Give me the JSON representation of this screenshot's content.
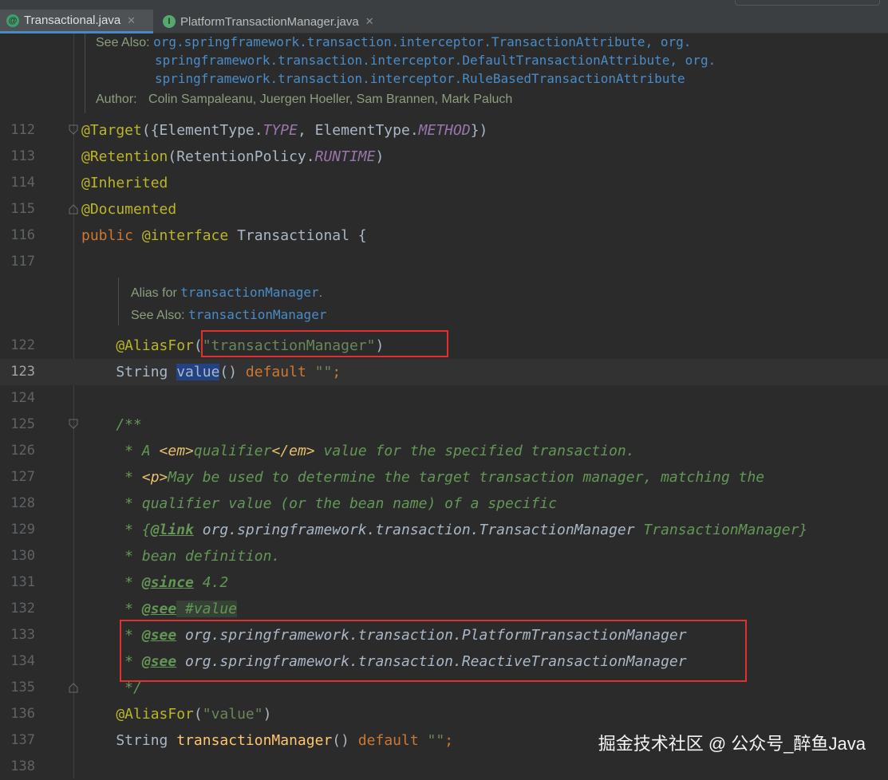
{
  "tabs": [
    {
      "label": "Transactional.java",
      "icon": "annotation-file-icon",
      "active": true
    },
    {
      "label": "PlatformTransactionManager.java",
      "icon": "interface-file-icon",
      "active": false
    }
  ],
  "top_doc": {
    "see_also_label": "See Also:",
    "see_also_links": [
      "org.springframework.transaction.interceptor.TransactionAttribute",
      "org.springframework.transaction.interceptor.DefaultTransactionAttribute",
      "org.springframework.transaction.interceptor.RuleBasedTransactionAttribute"
    ],
    "see_also_lines": [
      [
        "org.springframework.transaction.interceptor.TransactionAttribute",
        ", org."
      ],
      [
        "springframework.transaction.interceptor.DefaultTransactionAttribute",
        ", org."
      ],
      [
        "springframework.transaction.interceptor.RuleBasedTransactionAttribute",
        ""
      ]
    ],
    "author_label": "Author:",
    "authors": "Colin Sampaleanu, Juergen Hoeller, Sam Brannen, Mark Paluch"
  },
  "value_doc": {
    "alias_for_label": "Alias for",
    "alias_for_link": "transactionManager",
    "see_also_label": "See Also:",
    "see_also_link": "transactionManager"
  },
  "line_numbers": [
    "112",
    "113",
    "114",
    "115",
    "116",
    "117",
    "122",
    "123",
    "124",
    "125",
    "126",
    "127",
    "128",
    "129",
    "130",
    "131",
    "132",
    "133",
    "134",
    "135",
    "136",
    "137",
    "138"
  ],
  "code": {
    "l112": [
      "@Target",
      "({ElementType.",
      "TYPE",
      ", ElementType.",
      "METHOD",
      "})"
    ],
    "l113": [
      "@Retention",
      "(RetentionPolicy.",
      "RUNTIME",
      ")"
    ],
    "l114": [
      "@Inherited"
    ],
    "l115": [
      "@Documented"
    ],
    "l116": [
      "public ",
      "@interface ",
      "Transactional",
      " {"
    ],
    "l122": [
      "    @AliasFor",
      "(",
      "\"transactionManager\"",
      ")"
    ],
    "l123": [
      "    String ",
      "value",
      "() ",
      "default ",
      "\"\"",
      ";"
    ],
    "l125": [
      "    /**"
    ],
    "l126": [
      "     * A ",
      "<em>",
      "qualifier",
      "</em>",
      " value for the specified transaction."
    ],
    "l127": [
      "     * ",
      "<p>",
      "May be used to determine the target transaction manager, matching the"
    ],
    "l128": [
      "     * qualifier value (or the bean name) of a specific"
    ],
    "l129": [
      "     * {",
      "@link",
      " org.springframework.transaction.TransactionManager",
      " TransactionManager}"
    ],
    "l130": [
      "     * bean definition."
    ],
    "l131": [
      "     * ",
      "@since",
      " 4.2"
    ],
    "l132": [
      "     * ",
      "@see",
      " #value"
    ],
    "l133": [
      "     * ",
      "@see",
      " org.springframework.transaction.PlatformTransactionManager"
    ],
    "l134": [
      "     * ",
      "@see",
      " org.springframework.transaction.ReactiveTransactionManager"
    ],
    "l135": [
      "     */"
    ],
    "l136": [
      "    @AliasFor",
      "(",
      "\"value\"",
      ")"
    ],
    "l137": [
      "    String ",
      "transactionManager",
      "() ",
      "default ",
      "\"\"",
      ";"
    ]
  },
  "watermark": "掘金技术社区 @ 公众号_醉鱼Java",
  "colors": {
    "background": "#2b2b2b",
    "annotation": "#bbb529",
    "keyword": "#cc7832",
    "string": "#6a8759",
    "javadoc": "#629755",
    "constant": "#9876aa",
    "highlight_box": "#e03030"
  }
}
